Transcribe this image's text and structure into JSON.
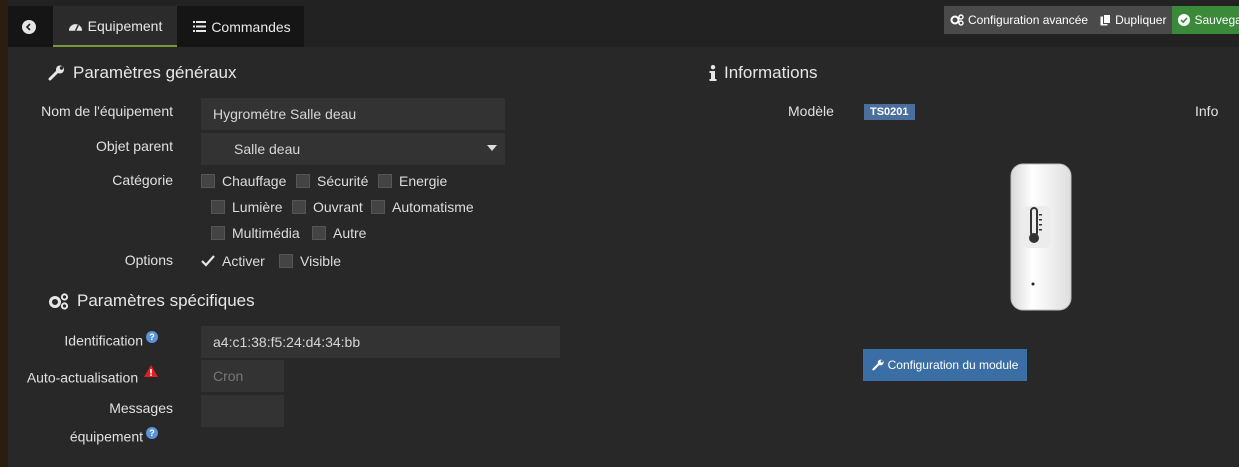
{
  "tabs": [
    {
      "label": "Equipement",
      "icon": "dashboard-icon"
    },
    {
      "label": "Commandes",
      "icon": "list-icon"
    }
  ],
  "toolbar": {
    "advanced_config": "Configuration avancée",
    "duplicate": "Dupliquer",
    "save": "Sauvegarder"
  },
  "general": {
    "title": "Paramètres généraux",
    "name_label": "Nom de l'équipement",
    "name_value": "Hygrométre Salle deau",
    "parent_label": "Objet parent",
    "parent_value": "Salle deau",
    "category_label": "Catégorie",
    "categories": [
      {
        "label": "Chauffage",
        "checked": false
      },
      {
        "label": "Sécurité",
        "checked": false
      },
      {
        "label": "Energie",
        "checked": false
      },
      {
        "label": "Lumière",
        "checked": false
      },
      {
        "label": "Ouvrant",
        "checked": false
      },
      {
        "label": "Automatisme",
        "checked": false
      },
      {
        "label": "Multimédia",
        "checked": false
      },
      {
        "label": "Autre",
        "checked": false
      }
    ],
    "options_label": "Options",
    "options": [
      {
        "label": "Activer",
        "checked": true
      },
      {
        "label": "Visible",
        "checked": false
      }
    ]
  },
  "specific": {
    "title": "Paramètres spécifiques",
    "ident_label": "Identification",
    "ident_value": "a4:c1:38:f5:24:d4:34:bb",
    "auto_label": "Auto-actualisation",
    "auto_placeholder": "Cron",
    "messages_label_1": "Messages",
    "messages_label_2": "équipement"
  },
  "info": {
    "title": "Informations",
    "model_label": "Modèle",
    "model_value": "TS0201",
    "info_label": "Info",
    "module_button": "Configuration du module"
  },
  "colors": {
    "accent_green": "#3a8a3a",
    "badge_blue": "#4a6f9f",
    "button_blue": "#3a6ea5",
    "warning_red": "#e02020",
    "help_blue": "#5b93d6"
  }
}
